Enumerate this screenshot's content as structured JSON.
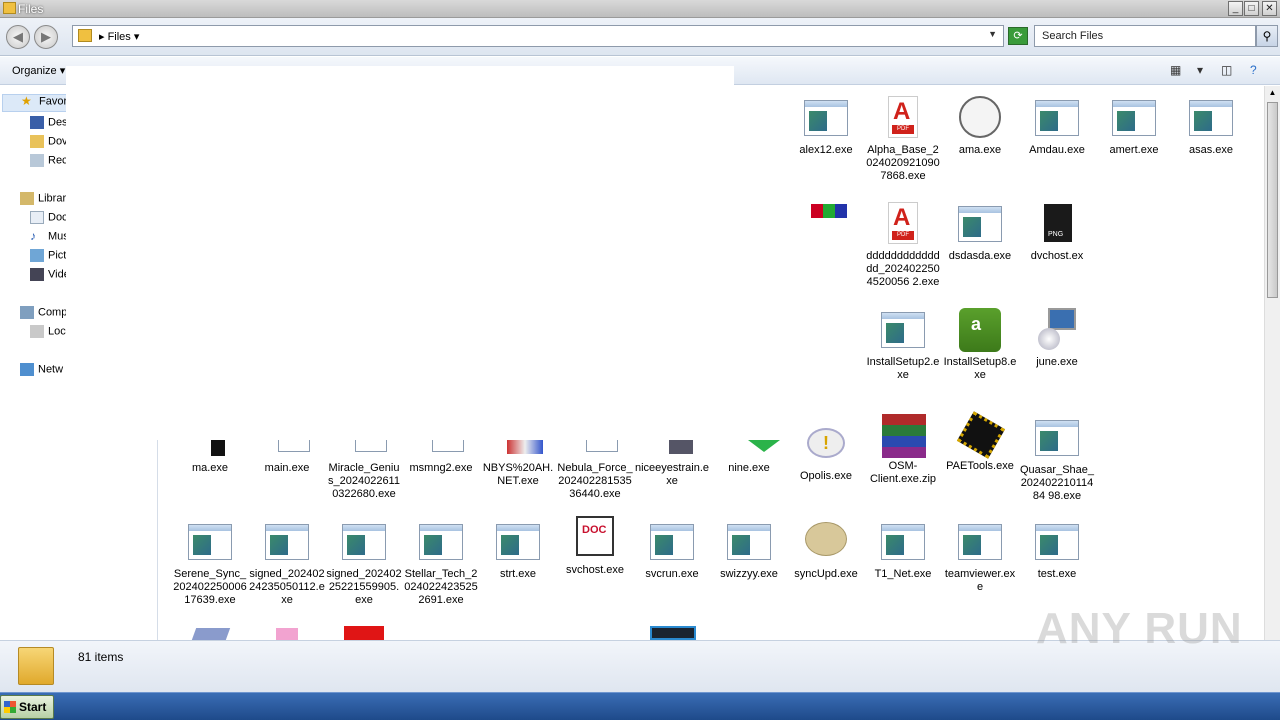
{
  "window": {
    "title": "Files"
  },
  "address": {
    "crumb": "Files",
    "search_placeholder": "Search Files"
  },
  "toolbar": {
    "organize_label": "Organize"
  },
  "nav": {
    "favorites": "Favori",
    "desktop": "Des",
    "downloads": "Dov",
    "recent": "Rec",
    "libraries": "Librar",
    "documents": "Doc",
    "music": "Mus",
    "pictures": "Pict",
    "videos": "Vide",
    "computer": "Comp",
    "local_disk": "Loc",
    "network": "Netw"
  },
  "files": {
    "alex12": "alex12.exe",
    "alpha": "Alpha_Base_20240209210907868.exe",
    "ama": "ama.exe",
    "amdau": "Amdau.exe",
    "amert": "amert.exe",
    "asas": "asas.exe",
    "ddd": "dddddddddddddd_2024022504520056 2.exe",
    "dsdasda": "dsdasda.exe",
    "dvchost": "dvchost.ex",
    "installsetup2": "InstallSetup2.exe",
    "installsetup8": "InstallSetup8.exe",
    "june": "june.exe",
    "ma": "ma.exe",
    "main": "main.exe",
    "miracle": "Miracle_Genius_20240226110322680.exe",
    "msmng2": "msmng2.exe",
    "nbys": "NBYS%20AH.NET.exe",
    "nebula": "Nebula_Force_20240228153536440.exe",
    "niceeye": "niceeyestrain.exe",
    "nine": "nine.exe",
    "opolis": "Opolis.exe",
    "osm": "OSM-Client.exe.zip",
    "paetools": "PAETools.exe",
    "quasar": "Quasar_Shae_20240221011484 98.exe",
    "serene": "Serene_Sync_20240225000617639.exe",
    "signed1": "signed_20240224235050112.exe",
    "signed2": "signed_20240225221559905.exe",
    "stellar": "Stellar_Tech_20240224235252691.exe",
    "strt": "strt.exe",
    "svchost": "svchost.exe",
    "svcrun": "svcrun.exe",
    "swizzyy": "swizzyy.exe",
    "syncupd": "syncUpd.exe",
    "t1net": "T1_Net.exe",
    "teamviewer": "teamviewer.exe",
    "test": "test.exe"
  },
  "status": {
    "count": "81 items"
  },
  "taskbar": {
    "start_label": "Start"
  },
  "watermark": "ANY RUN"
}
